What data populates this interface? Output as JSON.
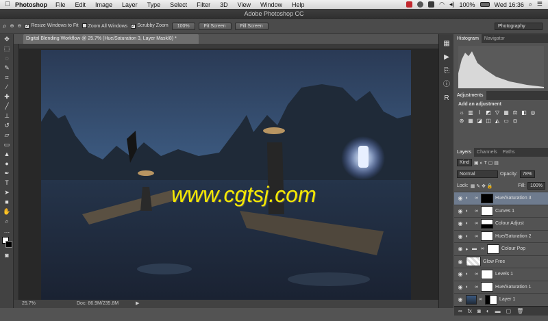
{
  "menubar": {
    "apple": "",
    "app": "Photoshop",
    "items": [
      "File",
      "Edit",
      "Image",
      "Layer",
      "Type",
      "Select",
      "Filter",
      "3D",
      "View",
      "Window",
      "Help"
    ],
    "battery": "100%",
    "clock": "Wed 16:36"
  },
  "window": {
    "title": "Adobe Photoshop CC"
  },
  "options": {
    "resize_label": "Resize Windows to Fit",
    "zoom_all_label": "Zoom All Windows",
    "scrubby_label": "Scrubby Zoom",
    "zoom_100": "100%",
    "fit_screen": "Fit Screen",
    "fill_screen": "Fill Screen",
    "workspace": "Photography"
  },
  "document": {
    "tab_title": "Digital Blending Workflow @ 25.7% (Hue/Saturation 3, Layer Mask/8) *",
    "watermark": "www.cgtsj.com"
  },
  "status": {
    "zoom": "25.7%",
    "doc": "Doc: 86.9M/235.8M"
  },
  "panels": {
    "histogram_tabs": [
      "Histogram",
      "Navigator"
    ],
    "adjust_tab": "Adjustments",
    "adjust_hint": "Add an adjustment",
    "layer_tabs": [
      "Layers",
      "Channels",
      "Paths"
    ],
    "kind": "Kind",
    "blend_mode": "Normal",
    "opacity_label": "Opacity:",
    "opacity_val": "78%",
    "lock_label": "Lock:",
    "fill_label": "Fill:",
    "fill_val": "100%",
    "layers": [
      {
        "name": "Hue/Saturation 3",
        "type": "adj",
        "mask": "black",
        "active": true
      },
      {
        "name": "Curves 1",
        "type": "adj",
        "mask": "white",
        "active": false
      },
      {
        "name": "Colour Adjust",
        "type": "adj",
        "mask": "mixed",
        "active": false
      },
      {
        "name": "Hue/Saturation 2",
        "type": "adj",
        "mask": "white",
        "active": false
      },
      {
        "name": "Colour Pop",
        "type": "group",
        "mask": "white",
        "active": false
      },
      {
        "name": "Glow Free",
        "type": "pixel",
        "mask": "none",
        "active": false
      },
      {
        "name": "Levels 1",
        "type": "adj",
        "mask": "white",
        "active": false
      },
      {
        "name": "Hue/Saturation 1",
        "type": "adj",
        "mask": "white",
        "active": false
      },
      {
        "name": "Layer 1",
        "type": "photo",
        "mask": "mixed",
        "active": false
      }
    ]
  },
  "colors": {
    "accent_active_layer": "#6e7b8e",
    "watermark": "#f5e900"
  }
}
